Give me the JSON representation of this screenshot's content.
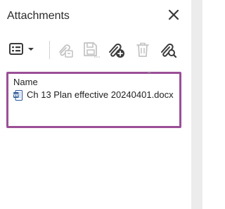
{
  "panel": {
    "title": "Attachments",
    "close_icon": "close-icon"
  },
  "toolbar": {
    "icons": [
      "options-menu-icon",
      "chevron-down-icon",
      "open-attachment-icon",
      "save-attachment-icon",
      "add-attachment-icon",
      "delete-attachment-icon",
      "search-attachment-icon"
    ]
  },
  "list": {
    "column_header": "Name",
    "items": [
      {
        "name": "Ch 13 Plan effective 20240401.docx",
        "icon": "word-document-icon"
      }
    ]
  },
  "colors": {
    "highlight_border": "#9b4f96",
    "word_icon_blue": "#2b579a"
  }
}
